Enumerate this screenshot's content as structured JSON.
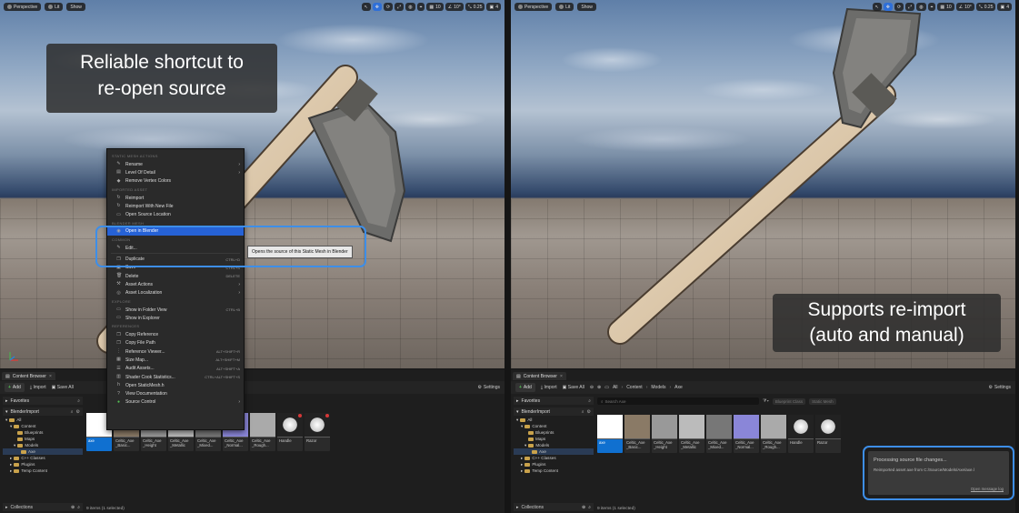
{
  "viewport": {
    "perspective_label": "Perspective",
    "lit_label": "Lit",
    "show_label": "Show",
    "grid_snap": "10",
    "rot_snap": "10°",
    "scale_snap": "0.25",
    "cam_speed": "4"
  },
  "left_caption": {
    "line1": "Reliable shortcut to",
    "line2": "re-open source"
  },
  "right_caption": {
    "line1": "Supports re-import",
    "line2": "(auto and manual)"
  },
  "context_menu": {
    "sec_static_mesh": "STATIC MESH ACTIONS",
    "rename": "Rename",
    "lod": "Level Of Detail",
    "remove_vertex_colors": "Remove Vertex Colors",
    "sec_imported": "IMPORTED ASSET",
    "reimport": "Reimport",
    "reimport_new": "Reimport With New File",
    "open_source_location": "Open Source Location",
    "sec_blender": "BLENDER MESH",
    "open_in_blender": "Open in Blender",
    "sec_common": "COMMON",
    "edit": "Edit...",
    "duplicate": "Duplicate",
    "duplicate_sc": "CTRL+D",
    "save": "Save",
    "save_sc": "CTRL+S",
    "delete": "Delete",
    "delete_sc": "DELETE",
    "asset_actions": "Asset Actions",
    "asset_localization": "Asset Localization",
    "sec_explore": "EXPLORE",
    "show_folder_view": "Show in Folder View",
    "show_folder_sc": "CTRL+B",
    "show_explorer": "Show in Explorer",
    "sec_references": "REFERENCES",
    "copy_reference": "Copy Reference",
    "copy_file_path": "Copy File Path",
    "reference_viewer": "Reference Viewer...",
    "reference_viewer_sc": "ALT+SHIFT+R",
    "size_map": "Size Map...",
    "size_map_sc": "ALT+SHIFT+M",
    "audit_assets": "Audit Assets...",
    "audit_assets_sc": "ALT+SHIFT+A",
    "shader_cook": "Shader Cook Statistics...",
    "shader_cook_sc": "CTRL+ALT+SHIFT+S",
    "open_staticmesh_h": "Open StaticMesh.h",
    "view_documentation": "View Documentation",
    "source_control": "Source Control"
  },
  "tooltip": "Opens the source of this Static Mesh in Blender",
  "content_browser": {
    "tab_label": "Content Browser",
    "add": "Add",
    "import": "Import",
    "save_all": "Save All",
    "settings": "Settings",
    "crumbs": [
      "All",
      "Content",
      "Models",
      "Axe"
    ],
    "search_placeholder": "Search Axe",
    "chip1": "Blueprint Class",
    "chip2": "Static Mesh",
    "favorites": "Favorites",
    "project": "BlenderImport",
    "collections": "Collections",
    "tree": [
      "All",
      "Content",
      "Blueprints",
      "Maps",
      "Models",
      "Axe",
      "C++ Classes",
      "Plugins",
      "Temp Content"
    ],
    "tiles": [
      "axe",
      "Celtic_Axe _Basic...",
      "Celtic_Axe _Height",
      "Celtic_Axe _Metallic",
      "Celtic_Axe _Mixed...",
      "Celtic_Axe _Normal...",
      "Celtic_Axe _Rough...",
      "Handle",
      "Razor"
    ],
    "items_count": "9 items (1 selected)"
  },
  "notification": {
    "title": "Processing source file changes...",
    "detail": "Reimported asset axe from C:/Source/Models/Axe/axe.l",
    "link": "Open message log"
  },
  "colors": {
    "accent": "#2662d6",
    "highlight_border": "#3d8ee8",
    "folder": "#c9a24b"
  }
}
